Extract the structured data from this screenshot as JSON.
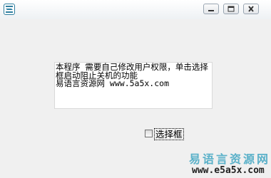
{
  "window": {
    "icons": {
      "app": "app-logo-icon",
      "minimize": "minimize-icon",
      "maximize": "maximize-icon",
      "close": "close-icon"
    }
  },
  "main": {
    "description": "本程序 需要自己修改用户权限，单击选择框启动阻止关机的功能\n易语言资源网 www.5a5x.com",
    "checkbox_label": "选择框",
    "checkbox_checked": false
  },
  "watermark": {
    "site_name": "易语言资源网",
    "url": "www.e5a5x.com",
    "color": "#5bb1c9"
  }
}
